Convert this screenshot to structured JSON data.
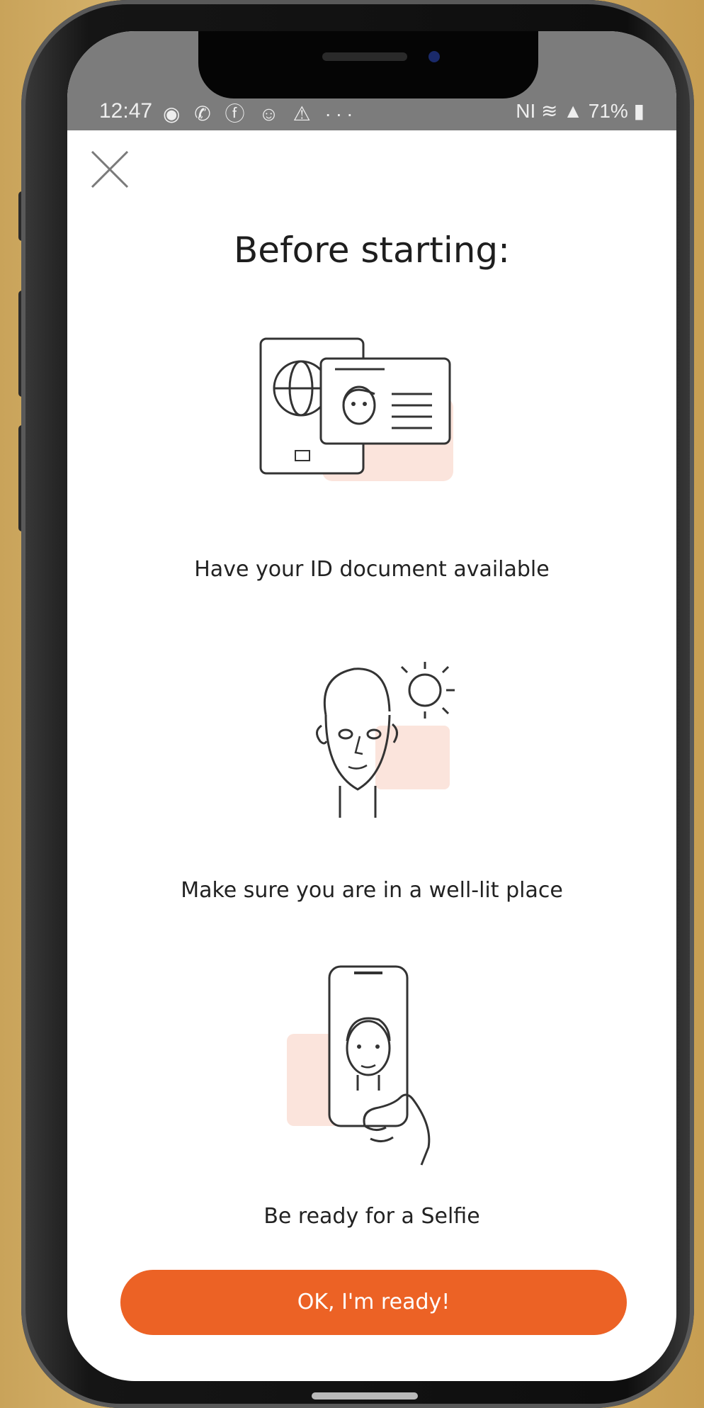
{
  "status_bar": {
    "time": "12:47",
    "notification_icons": "◉ ✆ ⓕ ☺ ⚠ ···",
    "right_indicators": "NI ≋ ▲ 71% ▮"
  },
  "header": {
    "title": "Before starting:"
  },
  "steps": [
    {
      "icon": "id-document-icon",
      "label": "Have your ID document available"
    },
    {
      "icon": "face-light-icon",
      "label": "Make sure you are in a well-lit place"
    },
    {
      "icon": "selfie-phone-icon",
      "label": "Be ready for a Selfie"
    }
  ],
  "actions": {
    "ok_label": "OK, I'm ready!"
  },
  "colors": {
    "accent": "#ec6225",
    "illustration_tint": "#fbe4dc",
    "status_bar": "#7c7c7c"
  }
}
